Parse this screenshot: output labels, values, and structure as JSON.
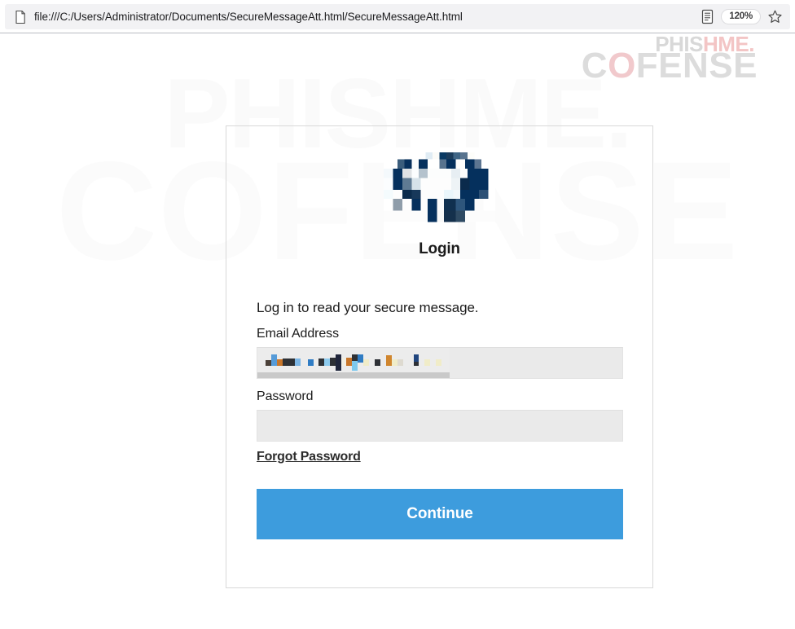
{
  "browser": {
    "url": "file:///C:/Users/Administrator/Documents/SecureMessageAtt.html/SecureMessageAtt.html",
    "page_icon": "document-icon",
    "reader_icon": "reader-mode-icon",
    "zoom_level": "120%",
    "bookmark_icon": "star-icon"
  },
  "brand": {
    "phishme_part1": "PHIS",
    "phishme_part2": "HME",
    "phishme_dot": ".",
    "cofense_c": "C",
    "cofense_o": "O",
    "cofense_rest": "FENSE",
    "watermark_top": "PHISHME.",
    "watermark_bottom": "COFENSE",
    "colors": {
      "gray": "#dcdcdc",
      "red": "#f1c9cc",
      "watermark": "#fafafa"
    }
  },
  "card": {
    "logo": "pixelated-company-logo",
    "title": "Login",
    "subtitle": "Log in to read your secure message.",
    "email": {
      "label": "Email Address",
      "value": "",
      "placeholder": "",
      "redacted": true
    },
    "password": {
      "label": "Password",
      "value": "",
      "placeholder": ""
    },
    "forgot_label": "Forgot Password",
    "continue_label": "Continue",
    "accent_color": "#3d9cdd"
  }
}
